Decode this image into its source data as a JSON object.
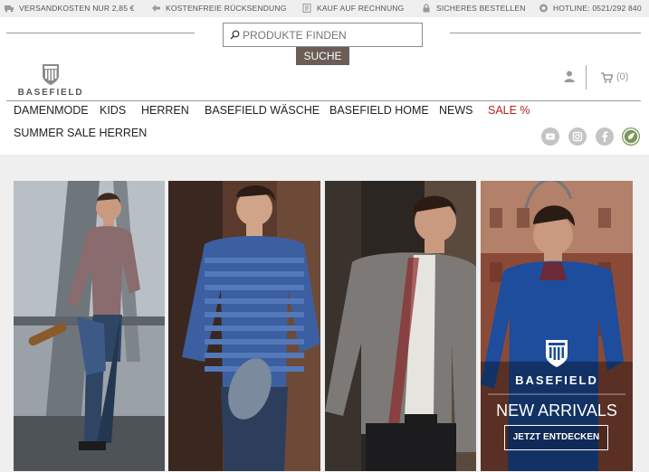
{
  "infobar": {
    "items": [
      {
        "icon": "truck-icon",
        "label": "VERSANDKOSTEN NUR 2,85 €"
      },
      {
        "icon": "return-arrow-icon",
        "label": "KOSTENFREIE RÜCKSENDUNG"
      },
      {
        "icon": "invoice-icon",
        "label": "KAUF AUF RECHNUNG"
      },
      {
        "icon": "lock-icon",
        "label": "SICHERES BESTELLEN"
      },
      {
        "icon": "headset-icon",
        "label": "HOTLINE: 0521/292 840"
      }
    ]
  },
  "search": {
    "placeholder": "PRODUKTE FINDEN",
    "button_label": "SUCHE"
  },
  "brand": {
    "name": "BASEFIELD"
  },
  "cart": {
    "count": "(0)"
  },
  "nav": {
    "items": [
      {
        "label": "DAMENMODE"
      },
      {
        "label": "KIDS"
      },
      {
        "label": "HERREN"
      },
      {
        "label": "BASEFIELD WÄSCHE"
      },
      {
        "label": "BASEFIELD HOME"
      },
      {
        "label": "NEWS"
      },
      {
        "label": "SALE %"
      }
    ],
    "second_row": {
      "label": "SUMMER SALE HERREN"
    }
  },
  "social": [
    "youtube-icon",
    "instagram-icon",
    "facebook-icon",
    "eco-badge-icon"
  ],
  "colors": {
    "sale": "#b22222",
    "search_button": "#6b5d55",
    "content_bg": "#efefef"
  },
  "promo": {
    "brand": "BASEFIELD",
    "headline": "NEW ARRIVALS",
    "cta_label": "JETZT ENTDECKEN"
  }
}
